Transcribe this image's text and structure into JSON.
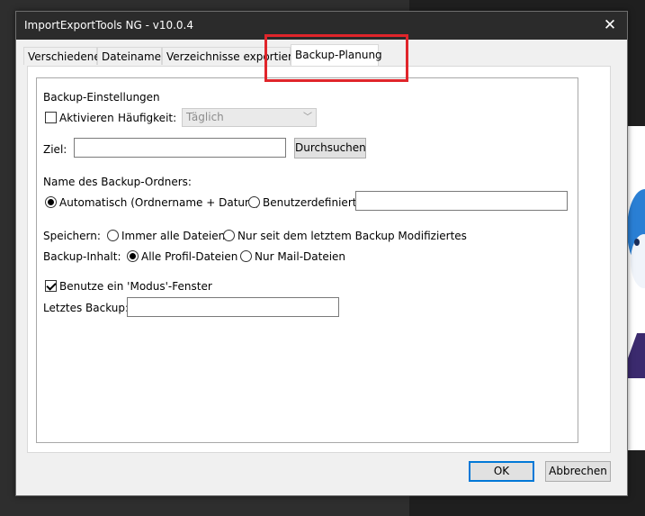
{
  "window": {
    "title": "ImportExportTools NG - v10.0.4",
    "close_glyph": "✕"
  },
  "tabs": [
    {
      "label": "Verschiedenes"
    },
    {
      "label": "Dateinamen"
    },
    {
      "label": "Verzeichnisse exportieren"
    },
    {
      "label": "Backup-Planung",
      "active": true
    }
  ],
  "group": {
    "title": "Backup-Einstellungen",
    "activate_label": "Aktivieren",
    "activate_checked": false,
    "frequency_label": "Häufigkeit:",
    "frequency_value": "Täglich",
    "target_label": "Ziel:",
    "target_value": "",
    "browse_label": "Durchsuchen",
    "folder_name_heading": "Name des Backup-Ordners:",
    "auto_label": "Automatisch (Ordnername + Datum)",
    "auto_checked": true,
    "custom_label": "Benutzerdefiniert:",
    "custom_value": "",
    "save_label": "Speichern:",
    "save_all_label": "Immer alle Dateien",
    "save_modified_label": "Nur seit dem letztem Backup Modifiziertes",
    "content_label": "Backup-Inhalt:",
    "content_all_label": "Alle Profil-Dateien",
    "content_all_checked": true,
    "content_mail_label": "Nur Mail-Dateien",
    "modal_label": "Benutze ein 'Modus'-Fenster",
    "modal_checked": true,
    "last_backup_label": "Letztes Backup:",
    "last_backup_value": ""
  },
  "footer": {
    "ok_label": "OK",
    "cancel_label": "Abbrechen"
  },
  "colors": {
    "highlight": "#e0252b",
    "accent": "#0078d7",
    "titlebar": "#2b2b2b"
  }
}
